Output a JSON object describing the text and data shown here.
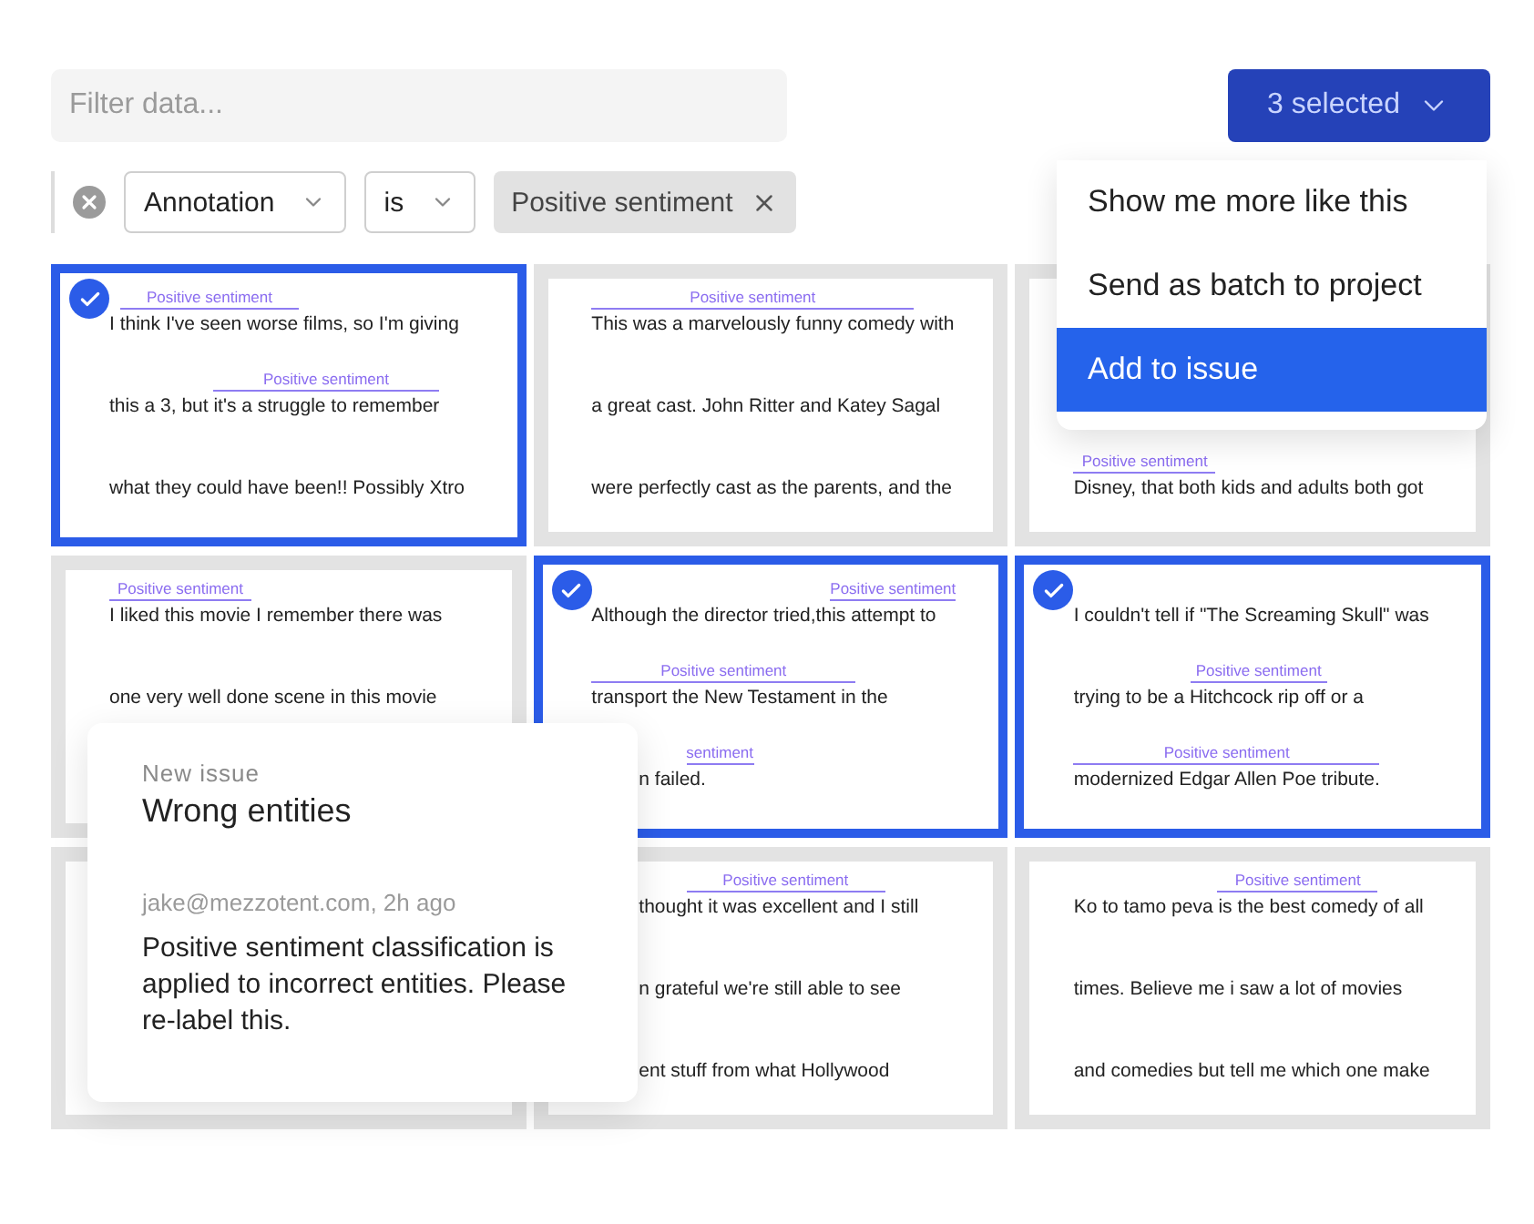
{
  "filter": {
    "placeholder": "Filter data..."
  },
  "selection_button": {
    "label": "3 selected"
  },
  "filter_row": {
    "field": "Annotation",
    "operator": "is",
    "value": "Positive sentiment"
  },
  "menu": {
    "items": [
      {
        "label": "Show me more like this",
        "selected": false
      },
      {
        "label": "Send as batch to project",
        "selected": false
      },
      {
        "label": "Add to issue",
        "selected": true
      }
    ]
  },
  "cards": [
    {
      "selected": true,
      "lines": [
        {
          "annotation": "Positive sentiment",
          "before": "I ",
          "tagged": "think I've seen worse",
          "after": " films, so I'm giving"
        },
        {
          "annotation": "Positive sentiment",
          "before": "this a 3, but ",
          "tagged": "it's a struggle to remember"
        },
        {
          "text": "what they could have been!! Possibly Xtro"
        }
      ]
    },
    {
      "selected": false,
      "lines": [
        {
          "annotation": "Positive sentiment",
          "tagged": "This was a marvelously funny comedy",
          "after": " with"
        },
        {
          "text": "a great cast. John Ritter and Katey Sagal"
        },
        {
          "text": "were perfectly cast as the parents, and the"
        }
      ]
    },
    {
      "selected": false,
      "lines": [
        {
          "annotation": "Positive sentiment",
          "tagged": "Disney, that both",
          "after": " kids and adults both got"
        }
      ]
    },
    {
      "selected": false,
      "lines": [
        {
          "annotation": "Positive sentiment",
          "tagged": "I liked this movie",
          "after": " I remember there was"
        },
        {
          "text": "one very well done scene in this movie"
        }
      ]
    },
    {
      "selected": true,
      "lines": [
        {
          "annotation": "Positive sentiment",
          "before": "Although the director tried,this ",
          "tagged": "attempt to"
        },
        {
          "annotation": "Positive sentiment",
          "tagged": "transport the New Testament in",
          "after": " the"
        },
        {
          "annotation": "sentiment",
          "tagged": "n",
          "after": " failed.",
          "cut": true
        }
      ]
    },
    {
      "selected": true,
      "lines": [
        {
          "text": "I couldn't tell if \"The Screaming Skull\" was"
        },
        {
          "annotation": "Positive sentiment",
          "before": "trying to be a ",
          "tagged": "Hitchcock rip off",
          "after": " or a"
        },
        {
          "annotation": "Positive sentiment",
          "tagged": "modernized Edgar Allen Poe tribute."
        }
      ]
    },
    {
      "selected": false
    },
    {
      "selected": false,
      "lines": [
        {
          "annotation": "Positive sentiment",
          "tagged": "thought it was excellent",
          "after": " and I still",
          "cut": true
        },
        {
          "text": "n grateful we're still able to see",
          "cut": true
        },
        {
          "text": "ent stuff from what Hollywood",
          "cut": true
        }
      ]
    },
    {
      "selected": false,
      "lines": [
        {
          "annotation": "Positive sentiment",
          "before": "Ko to tamo peva ",
          "tagged": "is the best comedy",
          "after": " of all"
        },
        {
          "text": "times. Believe me i saw a lot of movies"
        },
        {
          "text": "and comedies but tell me which one make"
        }
      ]
    }
  ],
  "issue": {
    "eyebrow": "New issue",
    "title": "Wrong entities",
    "meta": "jake@mezzotent.com, 2h ago",
    "body": "Positive sentiment classification is applied to incorrect entities. Please re-label this."
  }
}
